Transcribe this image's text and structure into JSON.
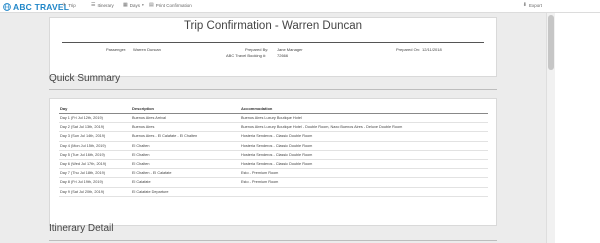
{
  "navbar": {
    "brand": "ABC TRAVEL",
    "items": [
      {
        "label": "Trip",
        "icon": "plane-icon"
      },
      {
        "label": "Itinerary",
        "icon": "list-icon"
      },
      {
        "label": "Days",
        "icon": "calendar-icon"
      },
      {
        "label": "Print Confirmation",
        "icon": "print-icon"
      }
    ],
    "export": "Export"
  },
  "header": {
    "title": "Trip Confirmation - Warren Duncan",
    "passenger_label": "Passenger:",
    "passenger_value": "Warren Duncan",
    "prepared_by_label": "Prepared By:",
    "prepared_by_value": "Jane Manager",
    "booking_label": "ABC Travel Booking #:",
    "booking_value": "72666",
    "prepared_on_label": "Prepared On:",
    "prepared_on_value": "12/11/2018"
  },
  "quick_summary": {
    "title": "Quick Summary",
    "columns": [
      "Day",
      "Description",
      "Accommodation"
    ],
    "rows": [
      [
        "Day 1 (Fri Jul 12th, 2019)",
        "Buenos Aires Arrival",
        "Buenos Aires Luxury Boutique Hotel"
      ],
      [
        "Day 2 (Sat Jul 13th, 2019)",
        "Buenos Aires",
        "Buenos Aires Luxury Boutique Hotel - Double Room, Naxo Buenos Aires - Deluxe Double Room"
      ],
      [
        "Day 3 (Sun Jul 14th, 2019)",
        "Buenos Aires - El Calafate - El Chalten",
        "Hosteria Senderos - Classic Double Room"
      ],
      [
        "Day 4 (Mon Jul 15th, 2019)",
        "El Chalten",
        "Hosteria Senderos - Classic Double Room"
      ],
      [
        "Day 5 (Tue Jul 16th, 2019)",
        "El Chalten",
        "Hosteria Senderos - Classic Double Room"
      ],
      [
        "Day 6 (Wed Jul 17th, 2019)",
        "El Chalten",
        "Hosteria Senderos - Classic Double Room"
      ],
      [
        "Day 7 (Thu Jul 18th, 2019)",
        "El Chalten - El Calafate",
        "Esto - Premium Room"
      ],
      [
        "Day 8 (Fri Jul 19th, 2019)",
        "El Calafate",
        "Esto - Premium Room"
      ],
      [
        "Day 9 (Sat Jul 20th, 2019)",
        "El Calafate Departure",
        ""
      ]
    ]
  },
  "itinerary": {
    "title": "Itinerary Detail"
  }
}
